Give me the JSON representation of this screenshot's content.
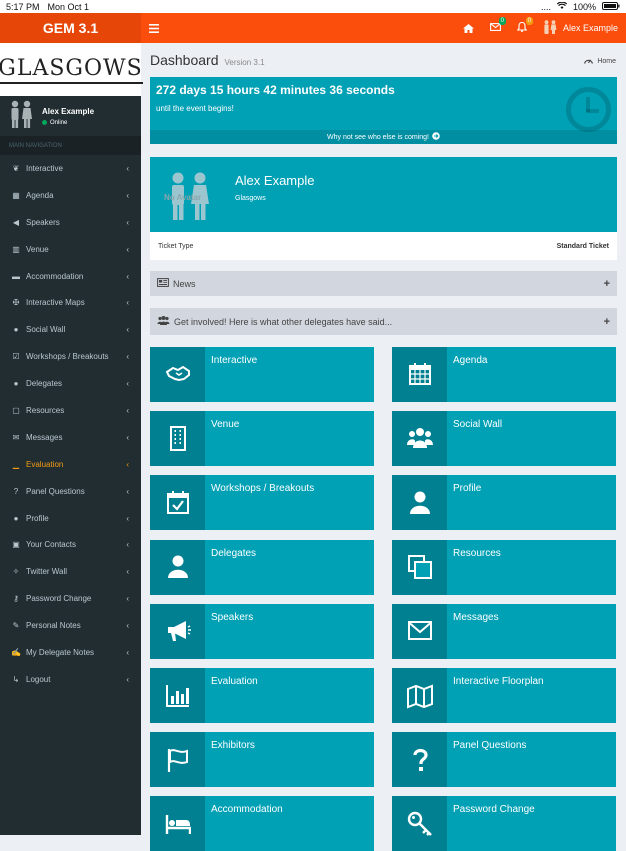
{
  "status_bar": {
    "time": "5:17 PM",
    "date": "Mon Oct 1",
    "signal": "....",
    "battery": "100%"
  },
  "header": {
    "brand": "GEM 3.1",
    "menu_icon": "hamburger-icon",
    "mail_badge": "0",
    "bell_badge": "0",
    "user_name": "Alex Example",
    "color": "#fb4d0b"
  },
  "sidebar": {
    "logo": "GLASGOWS",
    "user": {
      "name": "Alex Example",
      "status": "Online"
    },
    "section_header": "MAIN NAVIGATION",
    "items": [
      {
        "label": "Interactive",
        "icon": "handshake-icon"
      },
      {
        "label": "Agenda",
        "icon": "calendar-icon"
      },
      {
        "label": "Speakers",
        "icon": "megaphone-icon"
      },
      {
        "label": "Venue",
        "icon": "building-icon"
      },
      {
        "label": "Accommodation",
        "icon": "bed-icon"
      },
      {
        "label": "Interactive Maps",
        "icon": "signpost-icon"
      },
      {
        "label": "Social Wall",
        "icon": "users-icon"
      },
      {
        "label": "Workshops / Breakouts",
        "icon": "calendar-check-icon"
      },
      {
        "label": "Delegates",
        "icon": "user-icon"
      },
      {
        "label": "Resources",
        "icon": "copy-icon"
      },
      {
        "label": "Messages",
        "icon": "envelope-icon"
      },
      {
        "label": "Evaluation",
        "icon": "bar-chart-icon",
        "active": true
      },
      {
        "label": "Panel Questions",
        "icon": "question-icon"
      },
      {
        "label": "Profile",
        "icon": "user-icon"
      },
      {
        "label": "Your Contacts",
        "icon": "contact-icon"
      },
      {
        "label": "Twitter Wall",
        "icon": "twitter-icon"
      },
      {
        "label": "Password Change",
        "icon": "key-icon"
      },
      {
        "label": "Personal Notes",
        "icon": "pencil-icon"
      },
      {
        "label": "My Delegate Notes",
        "icon": "edit-icon"
      },
      {
        "label": "Logout",
        "icon": "sign-out-icon"
      }
    ]
  },
  "main": {
    "title": "Dashboard",
    "version": "Version 3.1",
    "breadcrumb": "Home",
    "countdown": {
      "text": "272 days 15 hours 42 minutes 36 seconds",
      "subtext": "until the event begins!",
      "footer": "Why not see who else is coming!"
    },
    "profile": {
      "name": "Alex Example",
      "location": "Glasgows",
      "avatar_text": "No Avatar",
      "ticket_label": "Ticket Type",
      "ticket_value": "Standard Ticket"
    },
    "news_label": "News",
    "involved_label": "Get involved! Here is what other delegates have said...",
    "tiles": [
      {
        "label": "Interactive",
        "icon": "handshake-icon"
      },
      {
        "label": "Agenda",
        "icon": "calendar-icon"
      },
      {
        "label": "Venue",
        "icon": "building-icon"
      },
      {
        "label": "Social Wall",
        "icon": "users-icon"
      },
      {
        "label": "Workshops / Breakouts",
        "icon": "calendar-check-icon"
      },
      {
        "label": "Profile",
        "icon": "user-icon"
      },
      {
        "label": "Delegates",
        "icon": "user-icon"
      },
      {
        "label": "Resources",
        "icon": "copy-icon"
      },
      {
        "label": "Speakers",
        "icon": "megaphone-icon"
      },
      {
        "label": "Messages",
        "icon": "envelope-icon"
      },
      {
        "label": "Evaluation",
        "icon": "bar-chart-icon"
      },
      {
        "label": "Interactive Floorplan",
        "icon": "map-icon"
      },
      {
        "label": "Exhibitors",
        "icon": "flag-icon"
      },
      {
        "label": "Panel Questions",
        "icon": "question-icon"
      },
      {
        "label": "Accommodation",
        "icon": "bed-icon"
      },
      {
        "label": "Password Change",
        "icon": "key-icon"
      }
    ]
  }
}
